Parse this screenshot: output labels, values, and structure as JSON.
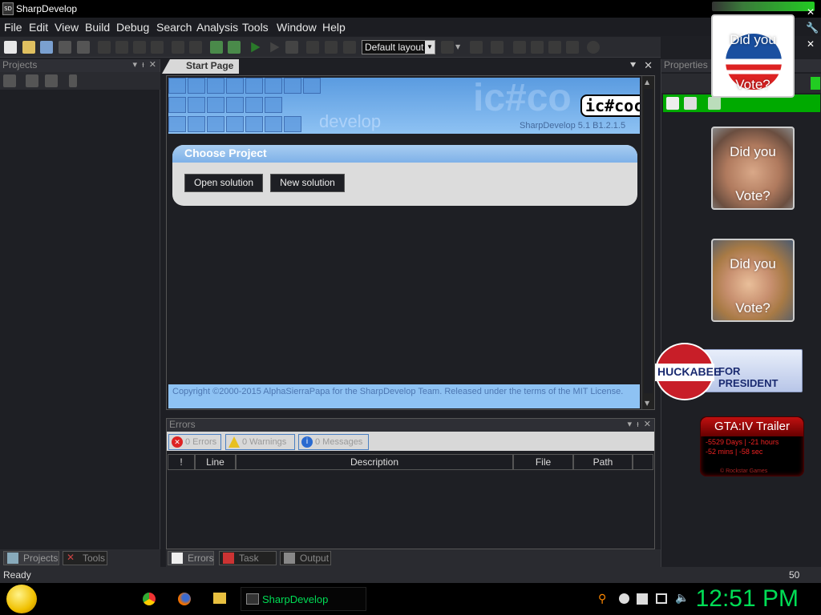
{
  "window": {
    "title": "SharpDevelop",
    "app_icon_text": "SD"
  },
  "menu": [
    "File",
    "Edit",
    "View",
    "Build",
    "Debug",
    "Search",
    "Analysis",
    "Tools",
    "Window",
    "Help"
  ],
  "toolbar": {
    "layout_value": "Default layout"
  },
  "projects_panel": {
    "title": "Projects"
  },
  "left_tabs": {
    "projects": "Projects",
    "tools": "Tools"
  },
  "doc_tab": {
    "title": "Start Page"
  },
  "start_page": {
    "banner_develop": "develop",
    "banner_big": "ic#co",
    "banner_version": "SharpDevelop 5.1 B1.2.1.5",
    "logo": "ic#coc",
    "choose_project_title": "Choose Project",
    "open_solution": "Open solution",
    "new_solution": "New solution",
    "copyright": "Copyright ©2000-2015 AlphaSierraPapa for the SharpDevelop Team.   Released under the terms of the MIT License."
  },
  "errors_panel": {
    "title": "Errors",
    "filter_errors": "0 Errors",
    "filter_warnings": "0 Warnings",
    "filter_messages": "0 Messages",
    "columns": [
      "!",
      "Line",
      "Description",
      "File",
      "Path"
    ]
  },
  "bottom_tabs": {
    "errors": "Errors",
    "task_list": "Task List",
    "output": "Output"
  },
  "properties_panel": {
    "title": "Properties"
  },
  "status": {
    "text": "Ready",
    "number": "50"
  },
  "taskbar": {
    "task_label": "SharpDevelop",
    "clock": "12:51 PM"
  },
  "widgets": {
    "vote_line1": "Did you",
    "vote_line2": "Vote?",
    "huckabee_name": "HUCKABEE",
    "huckabee_for": "FOR PRESIDENT",
    "gta_title": "GTA:IV Trailer",
    "gta_line1": "-5529 Days | -21 hours",
    "gta_line2": "-52 mins | -58 sec",
    "gta_footer": "© Rockstar Games"
  },
  "colors": {
    "accent_blue": "#7eb1e8",
    "status_green": "#00aa00",
    "clock_green": "#00dd55"
  }
}
